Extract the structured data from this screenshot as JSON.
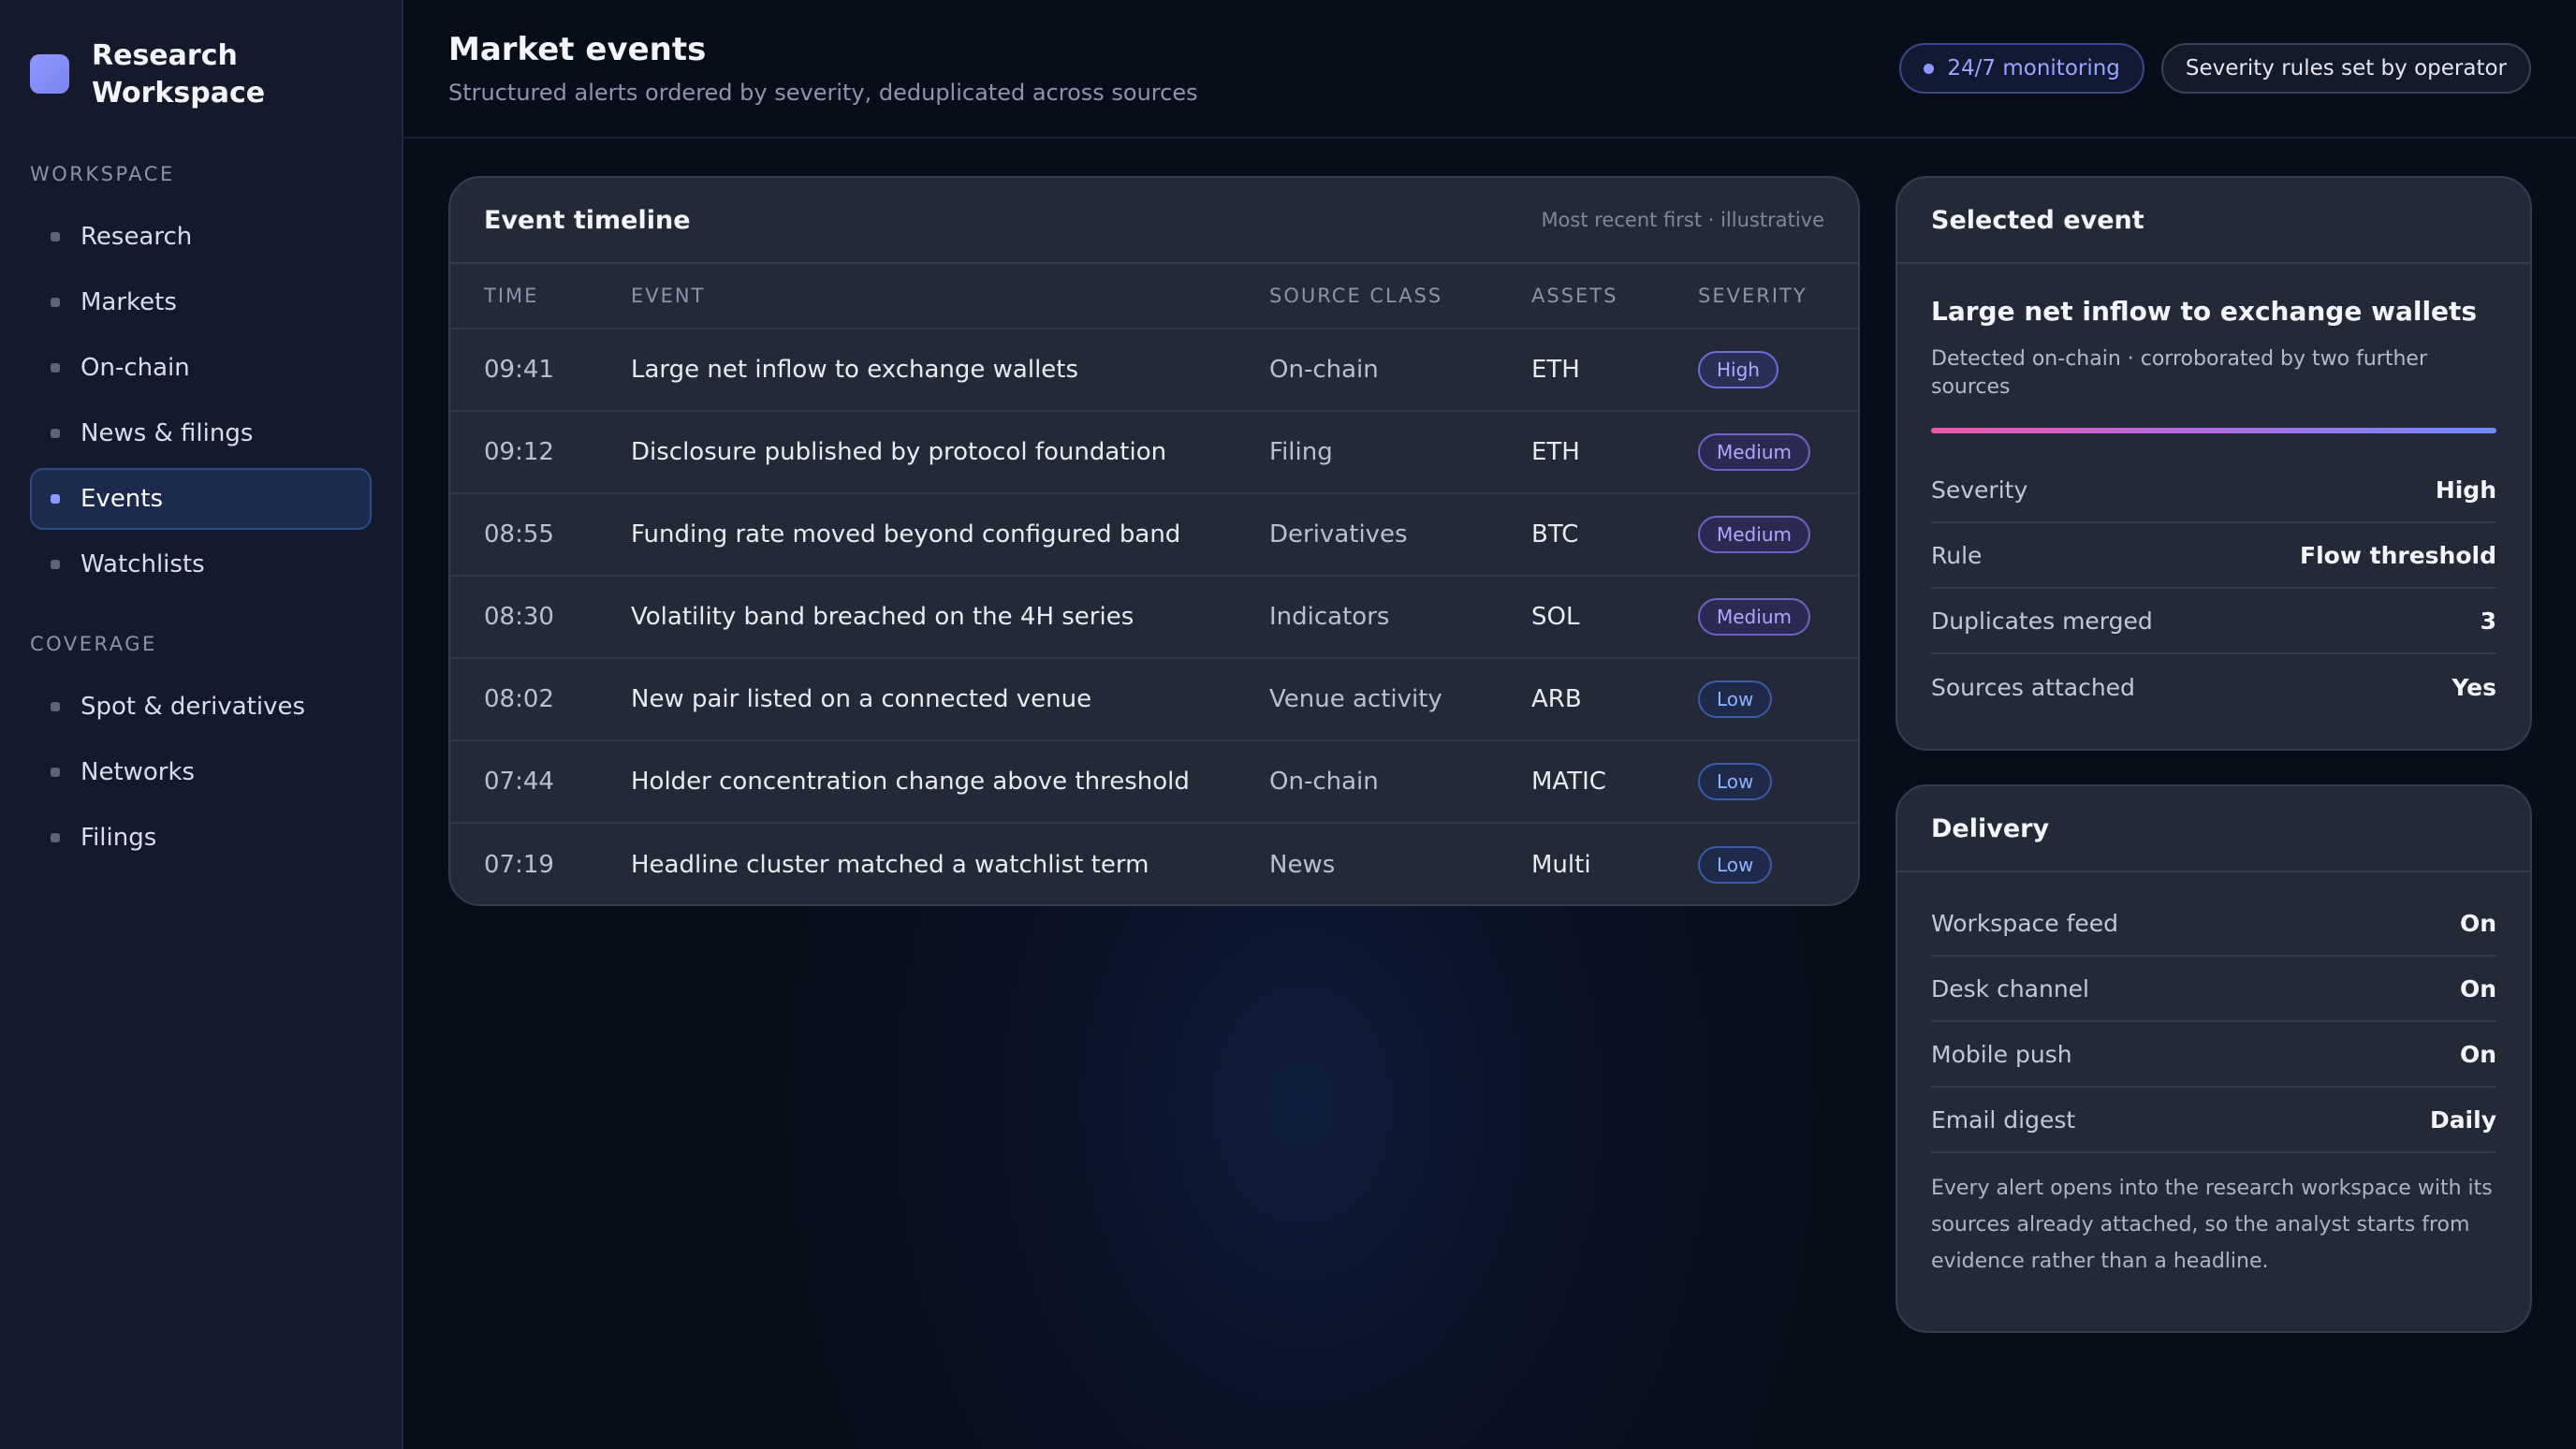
{
  "sidebar": {
    "brand": "Research Workspace",
    "workspace_label": "Workspace",
    "workspace_items": [
      {
        "label": "Research"
      },
      {
        "label": "Markets"
      },
      {
        "label": "On-chain"
      },
      {
        "label": "News & filings"
      },
      {
        "label": "Events",
        "active": true
      },
      {
        "label": "Watchlists"
      }
    ],
    "coverage_label": "Coverage",
    "coverage_items": [
      {
        "label": "Spot & derivatives"
      },
      {
        "label": "Networks"
      },
      {
        "label": "Filings"
      }
    ]
  },
  "header": {
    "title": "Market events",
    "subtitle": "Structured alerts ordered by severity, deduplicated across sources",
    "monitoring_pill": "24/7 monitoring",
    "rules_pill": "Severity rules set by operator"
  },
  "timeline": {
    "title": "Event timeline",
    "note": "Most recent first · illustrative",
    "columns": {
      "time": "Time",
      "event": "Event",
      "source": "Source class",
      "assets": "Assets",
      "severity": "Severity"
    },
    "rows": [
      {
        "time": "09:41",
        "event": "Large net inflow to exchange wallets",
        "source": "On-chain",
        "assets": "ETH",
        "severity": "High"
      },
      {
        "time": "09:12",
        "event": "Disclosure published by protocol foundation",
        "source": "Filing",
        "assets": "ETH",
        "severity": "Medium"
      },
      {
        "time": "08:55",
        "event": "Funding rate moved beyond configured band",
        "source": "Derivatives",
        "assets": "BTC",
        "severity": "Medium"
      },
      {
        "time": "08:30",
        "event": "Volatility band breached on the 4H series",
        "source": "Indicators",
        "assets": "SOL",
        "severity": "Medium"
      },
      {
        "time": "08:02",
        "event": "New pair listed on a connected venue",
        "source": "Venue activity",
        "assets": "ARB",
        "severity": "Low"
      },
      {
        "time": "07:44",
        "event": "Holder concentration change above threshold",
        "source": "On-chain",
        "assets": "MATIC",
        "severity": "Low"
      },
      {
        "time": "07:19",
        "event": "Headline cluster matched a watchlist term",
        "source": "News",
        "assets": "Multi",
        "severity": "Low"
      }
    ]
  },
  "selected_event": {
    "card_title": "Selected event",
    "title": "Large net inflow to exchange wallets",
    "description": "Detected on-chain · corroborated by two further sources",
    "fields": [
      {
        "label": "Severity",
        "value": "High"
      },
      {
        "label": "Rule",
        "value": "Flow threshold"
      },
      {
        "label": "Duplicates merged",
        "value": "3"
      },
      {
        "label": "Sources attached",
        "value": "Yes"
      }
    ]
  },
  "delivery": {
    "card_title": "Delivery",
    "fields": [
      {
        "label": "Workspace feed",
        "value": "On"
      },
      {
        "label": "Desk channel",
        "value": "On"
      },
      {
        "label": "Mobile push",
        "value": "On"
      },
      {
        "label": "Email digest",
        "value": "Daily"
      }
    ],
    "note": "Every alert opens into the research workspace with its sources already attached, so the analyst starts from evidence rather than a headline."
  },
  "colors": {
    "accent": "#8f98ff",
    "background": "#080d1a",
    "card": "#232937",
    "sidebar": "#141a2b"
  }
}
